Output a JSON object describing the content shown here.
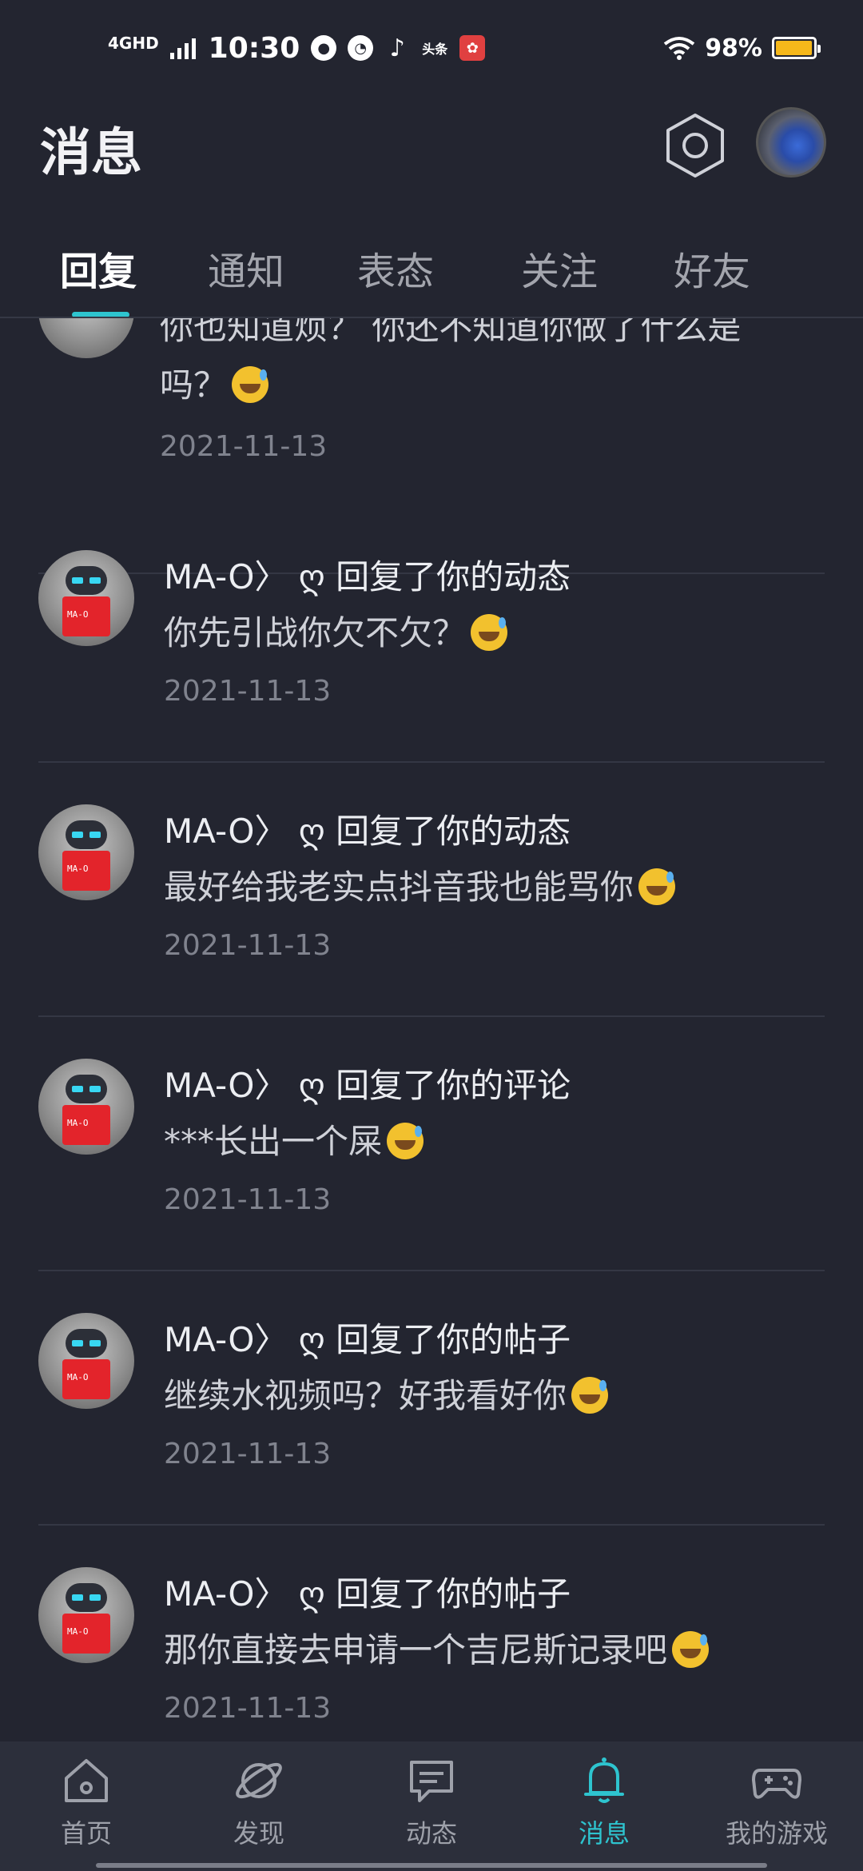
{
  "status_bar": {
    "network": "4GHD",
    "time": "10:30",
    "toutiao_label": "头条",
    "battery": "98%",
    "battery_level": 0.98
  },
  "header": {
    "title": "消息"
  },
  "tabs": [
    {
      "label": "回复",
      "active": true
    },
    {
      "label": "通知",
      "active": false
    },
    {
      "label": "表态",
      "active": false
    },
    {
      "label": "关注",
      "active": false
    },
    {
      "label": "好友",
      "active": false
    }
  ],
  "partial_item": {
    "line1": "你也知道烦？ 你还不知道你做了什么是",
    "line2": "吗？",
    "date": "2021-11-13"
  },
  "items": [
    {
      "name": "MA-O〉 ღ 回复了你的动态",
      "message": "你先引战你欠不欠？",
      "date": "2021-11-13",
      "avatar_text": "MA-O"
    },
    {
      "name": "MA-O〉 ღ 回复了你的动态",
      "message": "最好给我老实点抖音我也能骂你",
      "date": "2021-11-13",
      "avatar_text": "MA-O"
    },
    {
      "name": "MA-O〉 ღ 回复了你的评论",
      "message": "***长出一个屎",
      "date": "2021-11-13",
      "avatar_text": "MA-O"
    },
    {
      "name": "MA-O〉 ღ 回复了你的帖子",
      "message": "继续水视频吗？好我看好你",
      "date": "2021-11-13",
      "avatar_text": "MA-O"
    },
    {
      "name": "MA-O〉 ღ 回复了你的帖子",
      "message": "那你直接去申请一个吉尼斯记录吧",
      "date": "2021-11-13",
      "avatar_text": "MA-O"
    }
  ],
  "bottom_nav": [
    {
      "label": "首页",
      "icon": "home-icon",
      "active": false
    },
    {
      "label": "发现",
      "icon": "planet-icon",
      "active": false
    },
    {
      "label": "动态",
      "icon": "chat-bubble-icon",
      "active": false
    },
    {
      "label": "消息",
      "icon": "bell-icon",
      "active": true
    },
    {
      "label": "我的游戏",
      "icon": "gamepad-icon",
      "active": false
    }
  ],
  "colors": {
    "background": "#232530",
    "accent": "#2ec4cf",
    "nav_background": "#2c2f3b"
  }
}
